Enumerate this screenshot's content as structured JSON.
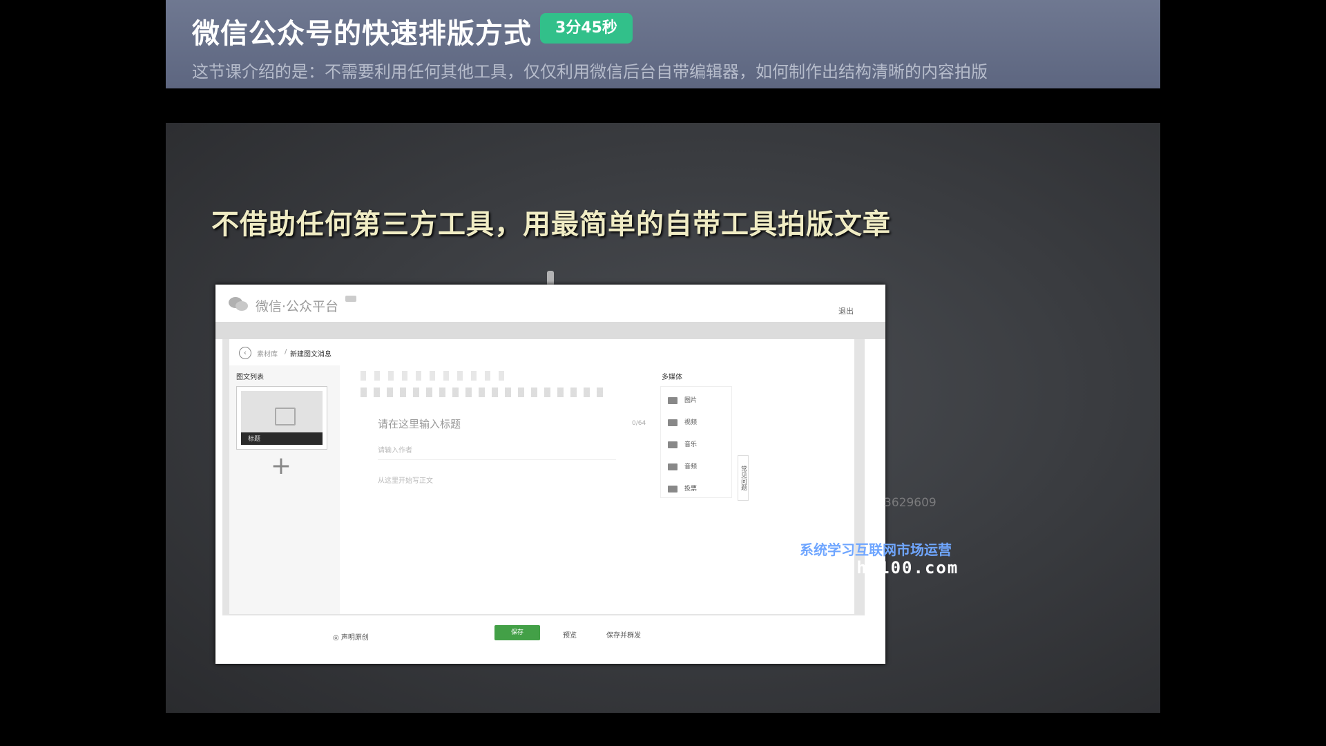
{
  "course": {
    "title": "微信公众号的快速排版方式",
    "duration": "3分45秒",
    "description": "这节课介绍的是：不需要利用任何其他工具，仅仅利用微信后台自带编辑器，如何制作出结构清晰的内容拍版"
  },
  "slide": {
    "headline": "不借助任何第三方工具，用最简单的自带工具拍版文章"
  },
  "editor": {
    "platform_name": "微信·公众平台",
    "logout": "退出",
    "breadcrumb_list": "素材库",
    "breadcrumb_sep": "/",
    "breadcrumb_current": "新建图文消息",
    "articles_label": "图文列表",
    "article_title": "标题",
    "add_symbol": "+",
    "title_placeholder": "请在这里输入标题",
    "title_counter": "0/64",
    "author_placeholder": "请输入作者",
    "body_placeholder": "从这里开始写正文",
    "media_label": "多媒体",
    "media_items": [
      "图片",
      "视频",
      "音乐",
      "音频",
      "投票"
    ],
    "feedback": "常见问题",
    "original_checkbox": "◎ 声明原创",
    "save": "保存",
    "preview": "预览",
    "save_send": "保存并群发"
  },
  "watermark": {
    "number": "3629609",
    "brand_cn": "系统学习互联网市场运营",
    "brand_url": "nuanshi100.com"
  }
}
